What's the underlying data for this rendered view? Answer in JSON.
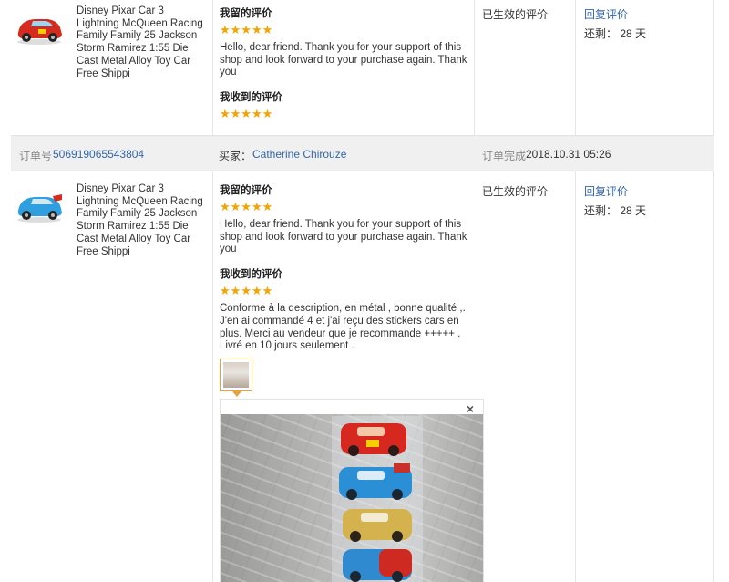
{
  "rows": [
    {
      "product_title": "Disney Pixar Car 3 Lightning McQueen Racing Family Family 25 Jackson Storm Ramirez 1:55 Die Cast Metal Alloy Toy Car Free Shippi",
      "my_review_label": "我留的评价",
      "my_rating": "★★★★★",
      "my_review_text": "Hello, dear friend. Thank you for your support of this shop and look forward to your purchase again. Thank you",
      "received_review_label": "我收到的评价",
      "received_rating": "★★★★★",
      "status": "已生效的评价",
      "reply_label": "回复评价",
      "remaining": "还剩： 28 天",
      "car_color": "#d42b1e"
    },
    {
      "product_title": "Disney Pixar Car 3 Lightning McQueen Racing Family Family 25 Jackson Storm Ramirez 1:55 Die Cast Metal Alloy Toy Car Free Shippi",
      "my_review_label": "我留的评价",
      "my_rating": "★★★★★",
      "my_review_text": "Hello, dear friend. Thank you for your support of this shop and look forward to your purchase again. Thank you",
      "received_review_label": "我收到的评价",
      "received_rating": "★★★★★",
      "received_review_text": "Conforme à la description, en métal , bonne qualité ,. J'en ai commandé 4 et j'ai reçu des stickers cars en plus. Merci au vendeur que je recommande +++++ . Livré en 10 jours seulement .",
      "status": "已生效的评价",
      "reply_label": "回复评价",
      "remaining": "还剩： 28 天",
      "car_color": "#2f9fe0"
    }
  ],
  "order_bar": {
    "order_no_label": "订单号",
    "order_no": "506919065543804",
    "buyer_label": "买家：",
    "buyer_name": "Catherine Chirouze",
    "complete_label": "订单完成",
    "complete_time": "2018.10.31 05:26"
  },
  "photo_viewer": {
    "close": "×"
  }
}
